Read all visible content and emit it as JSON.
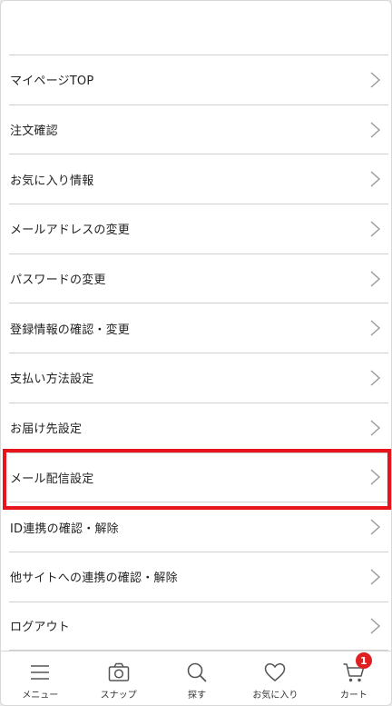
{
  "menu": {
    "items": [
      {
        "label": "マイページTOP"
      },
      {
        "label": "注文確認"
      },
      {
        "label": "お気に入り情報"
      },
      {
        "label": "メールアドレスの変更"
      },
      {
        "label": "パスワードの変更"
      },
      {
        "label": "登録情報の確認・変更"
      },
      {
        "label": "支払い方法設定"
      },
      {
        "label": "お届け先設定"
      },
      {
        "label": "メール配信設定"
      },
      {
        "label": "ID連携の確認・解除"
      },
      {
        "label": "他サイトへの連携の確認・解除"
      },
      {
        "label": "ログアウト"
      }
    ],
    "highlighted_item": "メール配信設定",
    "highlight_color": "#e8141b"
  },
  "bottom_nav": {
    "items": [
      {
        "label": "メニュー",
        "icon": "hamburger-menu-icon"
      },
      {
        "label": "スナップ",
        "icon": "camera-icon"
      },
      {
        "label": "探す",
        "icon": "search-icon"
      },
      {
        "label": "お気に入り",
        "icon": "heart-icon"
      },
      {
        "label": "カート",
        "icon": "cart-icon"
      }
    ],
    "cart_badge": "1",
    "badge_color": "#e02020"
  }
}
